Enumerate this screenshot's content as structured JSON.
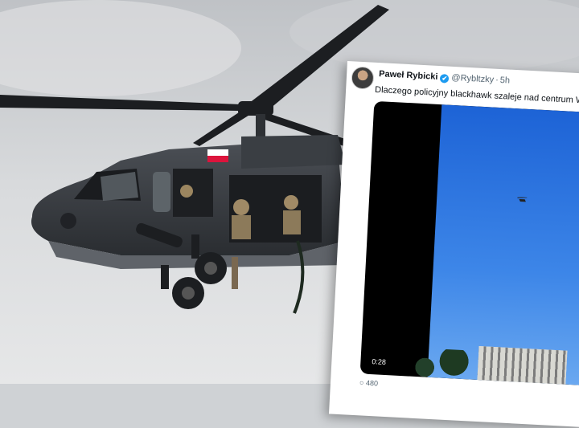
{
  "scene": {
    "subject": "helicopter-photo"
  },
  "tweet": {
    "author_name": "Paweł Rybicki",
    "handle": "@Rybltzky",
    "separator": "·",
    "time": "5h",
    "verified_icon": "✔",
    "text": "Dlaczego policyjny blackhawk szaleje nad centrum Wars",
    "video_duration": "0:28",
    "reply_count": "480"
  },
  "colors": {
    "verified": "#1d9bf0",
    "sky": "#3d86e8"
  }
}
